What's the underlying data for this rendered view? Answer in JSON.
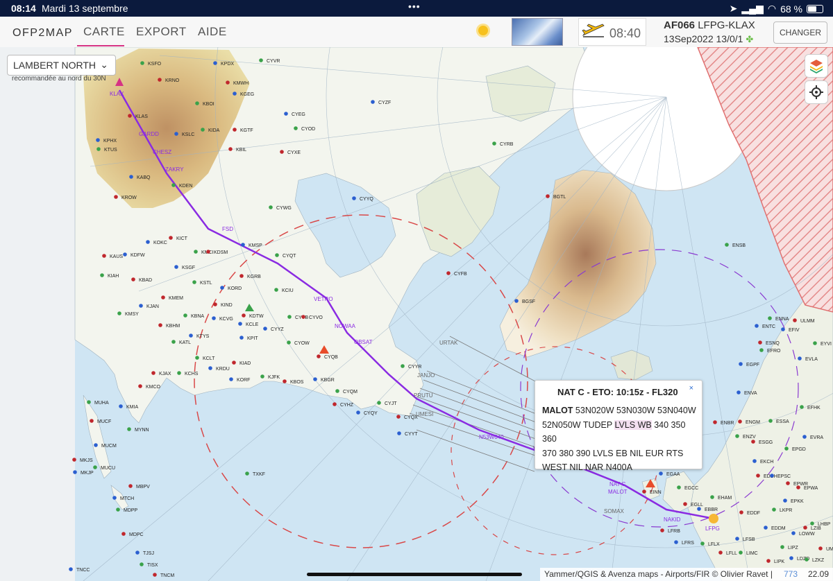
{
  "status_bar": {
    "time": "08:14",
    "date": "Mardi 13 septembre",
    "battery": "68 %",
    "battery_level": 0.68
  },
  "navbar": {
    "brand": "OFP2MAP",
    "tabs": [
      {
        "label": "CARTE",
        "active": true
      },
      {
        "label": "EXPORT"
      },
      {
        "label": "AIDE"
      }
    ],
    "clock": "08:40",
    "flight_number": "AF066",
    "route": "LFPG-KLAX",
    "flight_date": "13Sep2022 13/0/1",
    "change_label": "CHANGER"
  },
  "map": {
    "projection_label": "LAMBERT NORTH",
    "projection_hint": "recommandée au nord du 30N",
    "waypoints": [
      "KLAX",
      "GARDD",
      "CHESZ",
      "ZAKRY",
      "FSD",
      "VETRO",
      "NOWAA",
      "OBSAT",
      "N53W040",
      "NAT C",
      "MALOT",
      "NAKID",
      "LFPG"
    ],
    "airports": [
      "KSFO",
      "KRNO",
      "KPDX",
      "CYVR",
      "KMWH",
      "KGEG",
      "KBOI",
      "KLAS",
      "KSLC",
      "KIDA",
      "KGTF",
      "KPHX",
      "KTUS",
      "KBIL",
      "KABQ",
      "KDEN",
      "KROW",
      "CYEG",
      "CYOD",
      "CYXE",
      "CYZF",
      "CYRB",
      "BGTL",
      "CYYQ",
      "CYWG",
      "KICT",
      "KOKC",
      "KMCI",
      "KDSM",
      "KMSP",
      "CYQT",
      "KAUS",
      "KDFW",
      "KIAH",
      "KBAD",
      "KSGF",
      "KSTL",
      "KGRB",
      "KORD",
      "KCIU",
      "KMEM",
      "KJAN",
      "KMSY",
      "KIND",
      "KCVG",
      "KBNA",
      "KDTW",
      "KCLE",
      "CYYB",
      "CYVO",
      "CYYZ",
      "CYOW",
      "CYQB",
      "KPIT",
      "KATL",
      "KBHM",
      "KTYS",
      "KCLT",
      "KIAD",
      "KRDU",
      "KCHS",
      "KJAX",
      "KORF",
      "KJFK",
      "KBOS",
      "KBGR",
      "CYQM",
      "CYHZ",
      "CYQY",
      "CYJT",
      "CYQX",
      "CYYT",
      "CYYR",
      "CYFB",
      "BGSF",
      "ENSB",
      "KMCO",
      "KMIA",
      "MUHA",
      "MUCF",
      "MUCM",
      "MUCU",
      "MKJS",
      "MKJP",
      "MYNN",
      "MBPV",
      "MTCH",
      "MDPP",
      "MDPC",
      "TJSJ",
      "TISX",
      "TNCM",
      "TNCC",
      "TXKF",
      "EINN",
      "EGAA",
      "EGCC",
      "EGLL",
      "EBBR",
      "EHAM",
      "LFRB",
      "LFRS",
      "LFLX",
      "LFLL",
      "LFSB",
      "LIMC",
      "EDDF",
      "EDDM",
      "LKPR",
      "EPWA",
      "EVRA",
      "ESSA",
      "ENGM",
      "ENVA",
      "EFRO",
      "ESNQ",
      "ENTC",
      "ENNA",
      "ULMM",
      "EFIV",
      "EFHK",
      "ESGG",
      "EKCH",
      "EPGD",
      "EDDH",
      "EPKK",
      "LHBP",
      "LZIB",
      "LOWW",
      "LIPZ",
      "LIPK",
      "LDZD",
      "LZKZ",
      "UMKK",
      "EGPF",
      "ENZV",
      "ENBR",
      "EVLA",
      "EYVI",
      "EPWR",
      "EPSC"
    ],
    "tracks": [
      "URTAK",
      "JANJO",
      "PRUTU",
      "UMESI",
      "SOMAX"
    ],
    "volcano_icon": "volcano-triangle-icon",
    "layers_icon": "layers-icon",
    "locate_icon": "crosshair-icon"
  },
  "popup": {
    "title": "NAT C - ETO: 10:15z - FL320",
    "close": "×",
    "lead": "MALOT",
    "text_1": "53N020W 53N030W 53N040W",
    "text_2": "52N050W TUDEP",
    "text_2_hl": "LVLS WB",
    "text_3": "340 350 360",
    "text_4": "370 380 390 LVLS EB NIL EUR RTS",
    "text_5": "WEST NIL NAR N400A"
  },
  "attribution": {
    "credits": "Yammer/QGIS & Avenza maps - Airports/FIR © Olivier Ravet |",
    "count": "773",
    "clock": "22.09"
  },
  "colors": {
    "route": "#8a2be2",
    "accent": "#d63384",
    "airport_green": "#3aa24a",
    "airport_red": "#c0272d",
    "airport_blue": "#2b5fd0",
    "water": "#cfe5f3"
  }
}
